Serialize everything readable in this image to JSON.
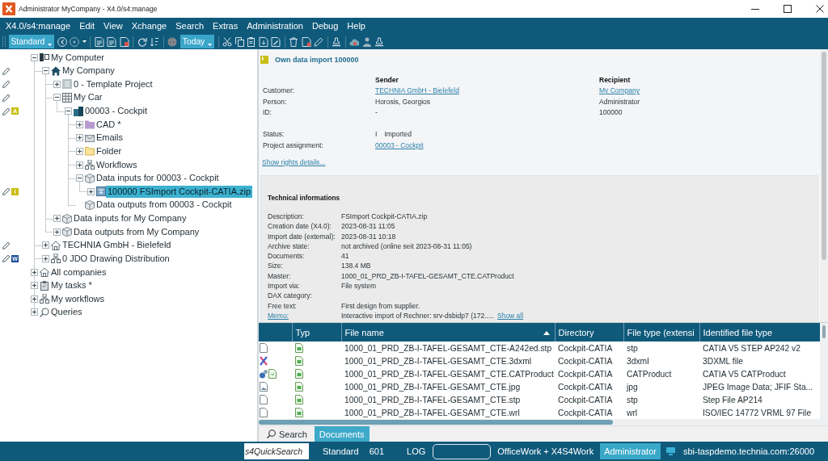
{
  "window": {
    "title": "Administrator MyCompany - X4.0/s4:manage"
  },
  "menu": [
    "X4.0/s4:manage",
    "Edit",
    "View",
    "Xchange",
    "Search",
    "Extras",
    "Administration",
    "Debug",
    "Help"
  ],
  "toolbar": {
    "profile": "Standard",
    "date_filter": "Today"
  },
  "tree": [
    {
      "label": "My Computer",
      "kind": "computer",
      "expanded": true,
      "leaf": false,
      "selected": false,
      "edit_mark": false,
      "children": [
        {
          "label": "My Company",
          "kind": "home",
          "expanded": true,
          "leaf": false,
          "selected": false,
          "edit_mark": true,
          "children": [
            {
              "label": "0 - Template Project",
              "kind": "template",
              "expanded": false,
              "leaf": false,
              "selected": false,
              "edit_mark": true
            },
            {
              "label": "My Car",
              "kind": "product",
              "expanded": true,
              "leaf": false,
              "selected": false,
              "edit_mark": true,
              "children": [
                {
                  "label": "00003 - Cockpit",
                  "kind": "project",
                  "expanded": true,
                  "leaf": false,
                  "selected": false,
                  "edit_mark": true,
                  "badge": {
                    "text": "A",
                    "color": "#c9be14"
                  },
                  "children": [
                    {
                      "label": "CAD *",
                      "kind": "cadfolder",
                      "expanded": false,
                      "leaf": false,
                      "selected": false,
                      "edit_mark": false
                    },
                    {
                      "label": "Emails",
                      "kind": "mail",
                      "expanded": false,
                      "leaf": false,
                      "selected": false,
                      "edit_mark": false
                    },
                    {
                      "label": "Folder",
                      "kind": "folder",
                      "expanded": false,
                      "leaf": false,
                      "selected": false,
                      "edit_mark": false
                    },
                    {
                      "label": "Workflows",
                      "kind": "workflow",
                      "expanded": false,
                      "leaf": false,
                      "selected": false,
                      "edit_mark": false
                    },
                    {
                      "label": "Data inputs for 00003 - Cockpit",
                      "kind": "databox",
                      "expanded": true,
                      "leaf": false,
                      "selected": false,
                      "edit_mark": false,
                      "children": [
                        {
                          "label": "100000 FSImport Cockpit-CATIA.zip",
                          "kind": "import",
                          "expanded": false,
                          "leaf": false,
                          "selected": true,
                          "edit_mark": true,
                          "badge": {
                            "text": "I",
                            "color": "#c9be14"
                          }
                        }
                      ]
                    },
                    {
                      "label": "Data outputs from 00003 - Cockpit",
                      "kind": "databox",
                      "expanded": false,
                      "leaf": true,
                      "selected": false,
                      "edit_mark": false
                    }
                  ]
                }
              ]
            },
            {
              "label": "Data inputs for My Company",
              "kind": "databox",
              "expanded": false,
              "leaf": false,
              "selected": false,
              "edit_mark": false
            },
            {
              "label": "Data outputs from My Company",
              "kind": "databox",
              "expanded": false,
              "leaf": false,
              "selected": false,
              "edit_mark": false
            }
          ]
        },
        {
          "label": "TECHNIA GmbH - Bielefeld",
          "kind": "house",
          "expanded": false,
          "leaf": false,
          "selected": false,
          "edit_mark": true
        },
        {
          "label": "0 JDO Drawing Distribution",
          "kind": "workflow",
          "expanded": false,
          "leaf": false,
          "selected": false,
          "edit_mark": true,
          "badge": {
            "text": "W",
            "color": "#1d4e9a"
          }
        }
      ]
    },
    {
      "label": "All companies",
      "kind": "house",
      "expanded": false,
      "leaf": false,
      "selected": false,
      "edit_mark": false
    },
    {
      "label": "My tasks *",
      "kind": "tasks",
      "expanded": false,
      "leaf": false,
      "selected": false,
      "edit_mark": false
    },
    {
      "label": "My workflows",
      "kind": "workflow",
      "expanded": false,
      "leaf": false,
      "selected": false,
      "edit_mark": false
    },
    {
      "label": "Queries",
      "kind": "query",
      "expanded": false,
      "leaf": false,
      "selected": false,
      "edit_mark": false
    }
  ],
  "details": {
    "title": "Own data import 100000",
    "parties": {
      "columns": [
        "Sender",
        "Recipient"
      ],
      "rows": [
        {
          "label": "Customer:",
          "kind": "link",
          "sender": "TECHNIA GmbH - Bielefeld",
          "recipient": "My Company"
        },
        {
          "label": "Person:",
          "kind": "text",
          "sender": "Horosis, Georgios",
          "recipient": "Administrator"
        },
        {
          "label": "ID:",
          "kind": "text",
          "sender": "-",
          "recipient": "100000"
        }
      ]
    },
    "status": {
      "label": "Status:",
      "code": "I",
      "value": "Imported"
    },
    "project": {
      "label": "Project assignment:",
      "value": "00003 - Cockpit"
    },
    "rights_link": "Show rights details...",
    "technical": {
      "title": "Technical informations",
      "rows": [
        {
          "label": "Description:",
          "kind": "text",
          "value": "FSImport Cockpit-CATIA.zip"
        },
        {
          "label": "Creation date (X4.0):",
          "kind": "text",
          "value": "2023-08-31 11:05"
        },
        {
          "label": "Import date (external):",
          "kind": "text",
          "value": "2023-08-31 10:18"
        },
        {
          "label": "Archive state:",
          "kind": "text",
          "value": "not archived (online seit 2023-08-31 11:05)"
        },
        {
          "label": "Documents:",
          "kind": "text",
          "value": "41"
        },
        {
          "label": "Size:",
          "kind": "text",
          "value": "138.4 MB"
        },
        {
          "label": "Master:",
          "kind": "text",
          "value": "1000_01_PRD_ZB-I-TAFEL-GESAMT_CTE.CATProduct"
        },
        {
          "label": "Import via:",
          "kind": "text",
          "value": "File system"
        },
        {
          "label": "DAX category:",
          "kind": "text"
        },
        {
          "label": "Free text:",
          "kind": "text",
          "value": "First design from supplier."
        },
        {
          "label": "Memo:",
          "kind": "link",
          "value": "Interactive import of Rechner: srv-dsbidp7 (172.....",
          "more": "Show all"
        }
      ]
    }
  },
  "files": {
    "columns": [
      {
        "sorted": false
      },
      {
        "label": "Typ",
        "sorted": false
      },
      {
        "label": "File name",
        "sorted": true
      },
      {
        "label": "Directory",
        "sorted": false
      },
      {
        "label": "File type (extensi",
        "sorted": false
      },
      {
        "label": "Identified file type",
        "sorted": false
      }
    ],
    "rows": [
      {
        "kind": "file",
        "selected": false,
        "cells": [
          "",
          "",
          "1000_01_PRD_ZB-I-TAFEL-GESAMT_CTE-A242ed.stp",
          "Cockpit-CATIA",
          "stp",
          "CATIA V5 STEP AP242 v2"
        ]
      },
      {
        "kind": "model",
        "selected": false,
        "cells": [
          "",
          "",
          "1000_01_PRD_ZB-I-TAFEL-GESAMT_CTE.3dxml",
          "Cockpit-CATIA",
          "3dxml",
          "3DXML file"
        ]
      },
      {
        "kind": "assembly",
        "selected": false,
        "cells": [
          "",
          "",
          "1000_01_PRD_ZB-I-TAFEL-GESAMT_CTE.CATProduct",
          "Cockpit-CATIA",
          "CATProduct",
          "CATIA V5 CATProduct"
        ]
      },
      {
        "kind": "image",
        "selected": false,
        "cells": [
          "",
          "",
          "1000_01_PRD_ZB-I-TAFEL-GESAMT_CTE.jpg",
          "Cockpit-CATIA",
          "jpg",
          "JPEG Image Data; JFIF Sta..."
        ]
      },
      {
        "kind": "file",
        "selected": false,
        "cells": [
          "",
          "",
          "1000_01_PRD_ZB-I-TAFEL-GESAMT_CTE.stp",
          "Cockpit-CATIA",
          "stp",
          "Step File AP214"
        ]
      },
      {
        "kind": "file",
        "selected": false,
        "cells": [
          "",
          "",
          "1000_01_PRD_ZB-I-TAFEL-GESAMT_CTE.wrl",
          "Cockpit-CATIA",
          "wrl",
          "ISO/IEC 14772 VRML 97 File"
        ]
      }
    ]
  },
  "tabs": [
    {
      "label": "Search",
      "kind": "search",
      "selected": false
    },
    {
      "label": "Documents",
      "kind": "plain",
      "selected": true
    }
  ],
  "status_bar": {
    "quick_search": {
      "placeholder": "s4QuickSearch"
    },
    "profile": "Standard",
    "count": "601",
    "log": "LOG",
    "workspace": "OfficeWork + X4S4Work",
    "user": "Administrator",
    "server": "sbi-taspdemo.technia.com:26000"
  }
}
